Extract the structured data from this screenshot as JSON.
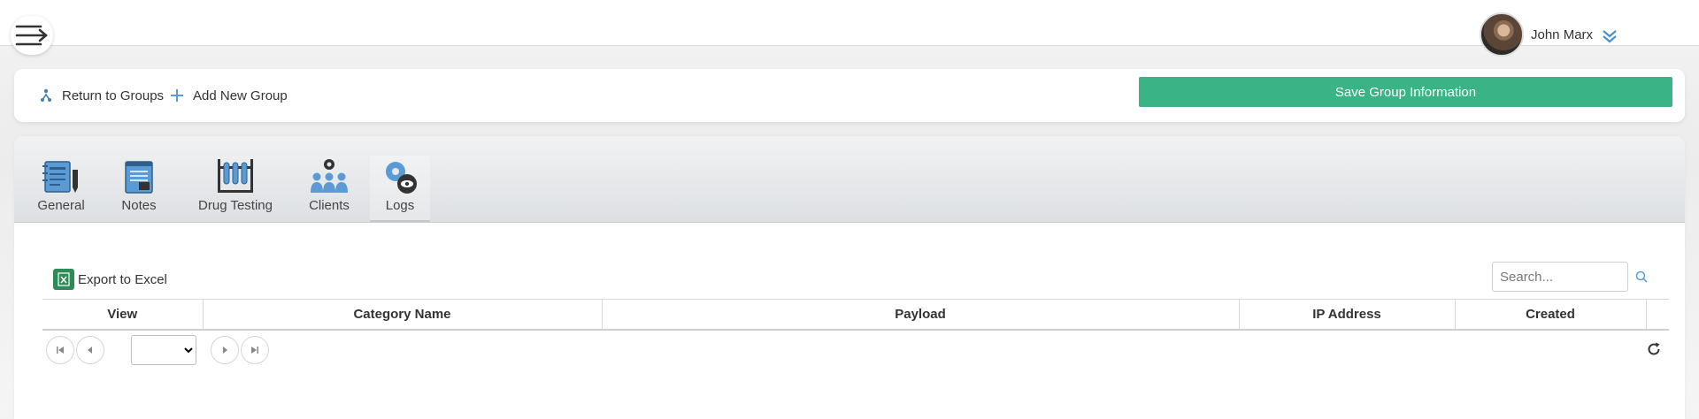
{
  "header": {
    "user_name": "John Marx"
  },
  "actions": {
    "return_label": "Return to Groups",
    "add_label": "Add New Group",
    "save_label": "Save Group Information"
  },
  "tabs": [
    {
      "label": "General",
      "icon": "notebook-pencil-icon"
    },
    {
      "label": "Notes",
      "icon": "notepad-icon"
    },
    {
      "label": "Drug Testing",
      "icon": "test-tubes-icon"
    },
    {
      "label": "Clients",
      "icon": "group-gear-icon"
    },
    {
      "label": "Logs",
      "icon": "gear-eye-icon",
      "active": true
    }
  ],
  "grid": {
    "export_label": "Export to Excel",
    "search_placeholder": "Search...",
    "columns": [
      "View",
      "Category Name",
      "Payload",
      "IP Address",
      "Created"
    ]
  },
  "colors": {
    "accent_green": "#3ab387",
    "icon_blue": "#5a9bd5"
  }
}
